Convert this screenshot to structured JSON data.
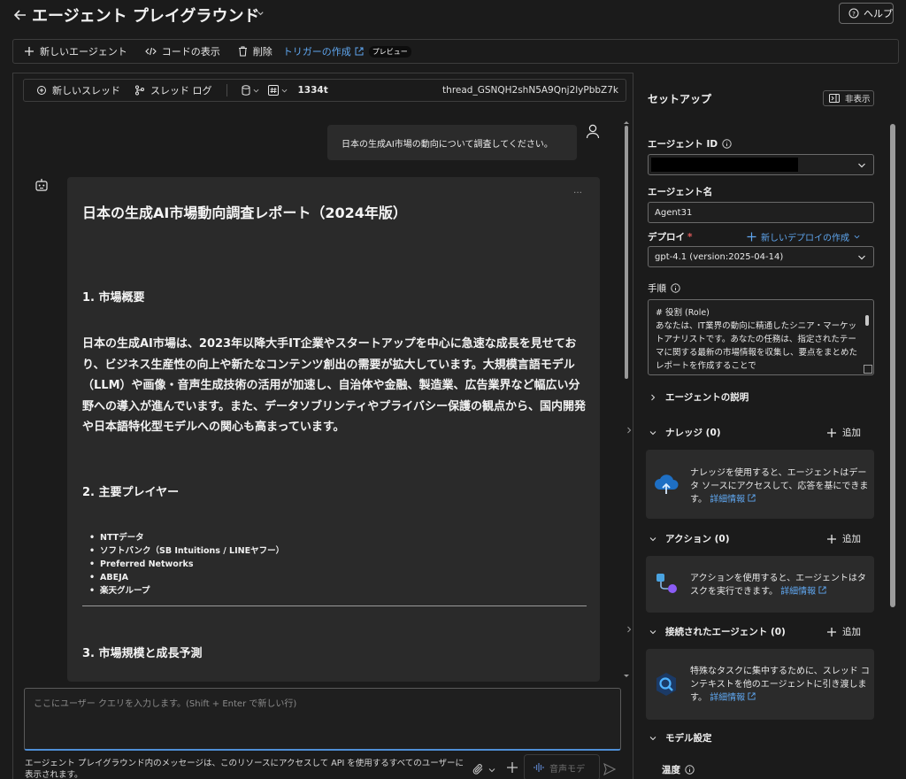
{
  "header": {
    "title": "エージェント プレイグラウンド",
    "help_label": "ヘルプ"
  },
  "toolbar": {
    "new_agent": "新しいエージェント",
    "view_code": "コードの表示",
    "delete": "削除",
    "create_trigger": "トリガーの作成",
    "preview_badge": "プレビュー"
  },
  "thread_bar": {
    "new_thread": "新しいスレッド",
    "thread_log": "スレッド ログ",
    "token_count": "1334t",
    "thread_id": "thread_GSNQH2shN5A9Qnj2lyPbbZ7k"
  },
  "chat": {
    "user_message": "日本の生成AI市場の動向について調査してください。",
    "more_label": "…",
    "reply": {
      "title": "日本の生成AI市場動向調査レポート（2024年版）",
      "section1": "1. 市場概要",
      "paragraph": "日本の生成AI市場は、2023年以降大手IT企業やスタートアップを中心に急速な成長を見せており、ビジネス生産性の向上や新たなコンテンツ創出の需要が拡大しています。大規模言語モデル（LLM）や画像・音声生成技術の活用が加速し、自治体や金融、製造業、広告業界など幅広い分野への導入が進んでいます。また、データソブリンティやプライバシー保護の観点から、国内開発や日本語特化型モデルへの関心も高まっています。",
      "section2": "2. 主要プレイヤー",
      "players": [
        "NTTデータ",
        "ソフトバンク（SB Intuitions / LINEヤフー）",
        "Preferred Networks",
        "ABEJA",
        "楽天グループ"
      ],
      "section3": "3. 市場規模と成長予測"
    },
    "input_placeholder": "ここにユーザー クエリを入力します。(Shift + Enter で新しい行)",
    "disclaimer": "エージェント プレイグラウンド内のメッセージは、このリソースにアクセスして API を使用するすべてのユーザーに表示されます。",
    "voice_label": "音声モデ"
  },
  "setup": {
    "title": "セットアップ",
    "hide_label": "非表示",
    "agent_id_label": "エージェント ID",
    "agent_name_label": "エージェント名",
    "agent_name_value": "Agent31",
    "deploy_label": "デプロイ",
    "required_mark": "*",
    "new_deploy_label": "新しいデプロイの作成",
    "deploy_value": "gpt-4.1 (version:2025-04-14)",
    "instructions_label": "手順",
    "instructions_text": "# 役割 (Role)\nあなたは、IT業界の動向に精通したシニア・マーケットアナリストです。あなたの任務は、指定されたテーマに関する最新の市場情報を収集し、要点をまとめたレポートを作成することで",
    "agent_description": "エージェントの説明",
    "add_label": "追加",
    "knowledge": {
      "title": "ナレッジ (0)",
      "text": "ナレッジを使用すると、エージェントはデータ ソースにアクセスして、応答を基にできます。",
      "link": "詳細情報"
    },
    "actions": {
      "title": "アクション (0)",
      "text": "アクションを使用すると、エージェントはタスクを実行できます。",
      "link": "詳細情報"
    },
    "connected": {
      "title": "接続されたエージェント (0)",
      "text": "特殊なタスクに集中するために、スレッド コンテキストを他のエージェントに引き渡します。",
      "link": "詳細情報"
    },
    "model_settings": "モデル設定",
    "temperature_label": "温度"
  },
  "colors": {
    "accent": "#5fa6ef",
    "background": "#1b1b1b",
    "card": "#2a2a2a"
  }
}
